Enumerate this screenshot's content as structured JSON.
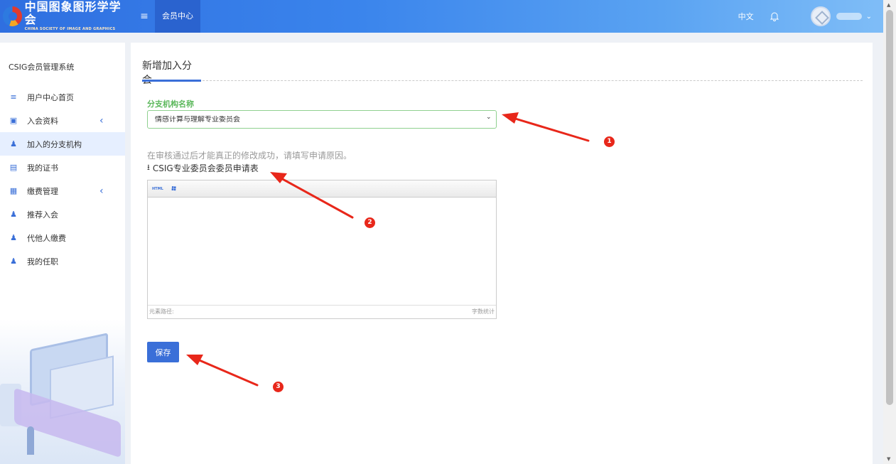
{
  "header": {
    "logo_cn": "中国图象图形学学会",
    "logo_en": "CHINA SOCIETY OF IMAGE AND GRAPHICS",
    "nav_label": "会员中心",
    "lang": "中文"
  },
  "sidebar": {
    "title": "CSIG会员管理系统",
    "items": [
      {
        "label": "用户中心首页"
      },
      {
        "label": "入会资料"
      },
      {
        "label": "加入的分支机构"
      },
      {
        "label": "我的证书"
      },
      {
        "label": "缴费管理"
      },
      {
        "label": "推荐入会"
      },
      {
        "label": "代他人缴费"
      },
      {
        "label": "我的任职"
      }
    ]
  },
  "main": {
    "tab_label": "新增加入分会",
    "field_label": "分支机构名称",
    "branch_selected": "情感计算与理解专业委员会",
    "note": "在审核通过后才能真正的修改成功，请填写申请原因。",
    "download_label": "CSIG专业委员会委员申请表",
    "editor": {
      "html_label": "HTML",
      "status_left": "元素路径:",
      "status_right": "字数统计"
    },
    "save_label": "保存"
  },
  "annotations": [
    "1",
    "2",
    "3"
  ],
  "colors": {
    "accent": "#3a6fd8",
    "label_green": "#5cb85c",
    "annotation_red": "#e8271a"
  }
}
